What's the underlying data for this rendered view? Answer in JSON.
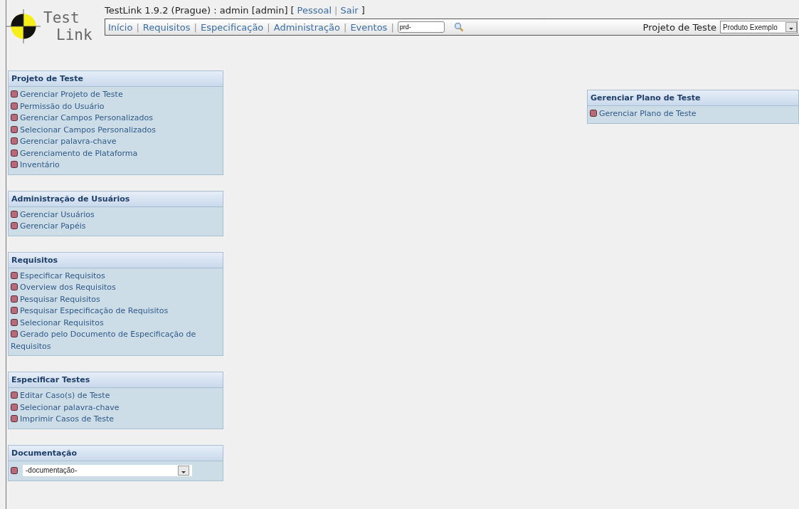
{
  "logo": {
    "top": "Test",
    "bottom": "Link"
  },
  "header": {
    "title": "TestLink 1.9.2 (Prague) : admin [admin]",
    "open": "[",
    "links": [
      "Pessoal",
      "Sair"
    ],
    "separator": "|",
    "close": "]"
  },
  "nav": {
    "items": [
      "Início",
      "Requisitos",
      "Especificação",
      "Administração",
      "Eventos"
    ],
    "separator": "|",
    "search": {
      "value": "prd-"
    }
  },
  "project": {
    "label": "Projeto de Teste",
    "value": "Produto Exemplo"
  },
  "left_panels": [
    {
      "title": "Projeto de Teste",
      "kind": "links",
      "items": [
        "Gerenciar Projeto de Teste",
        "Permissão do Usuário",
        "Gerenciar Campos Personalizados",
        "Selecionar Campos Personalizados",
        "Gerenciar palavra-chave",
        "Gerenciamento de Plataforma",
        "Inventário"
      ]
    },
    {
      "title": "Administração de Usuários",
      "kind": "links",
      "items": [
        "Gerenciar Usuários",
        "Gerenciar Papéis"
      ]
    },
    {
      "title": "Requisitos",
      "kind": "links",
      "items": [
        "Especificar Requisitos",
        "Overview dos Requisitos",
        "Pesquisar Requisitos",
        "Pesquisar Especificação de Requisitos",
        "Selecionar Requisitos",
        "Gerado pelo Documento de Especificação de Requisitos"
      ]
    },
    {
      "title": "Especificar Testes",
      "kind": "links",
      "items": [
        "Editar Caso(s) de Teste",
        "Selecionar palavra-chave",
        "Imprimir Casos de Teste"
      ]
    },
    {
      "title": "Documentação",
      "kind": "select",
      "value": "-documentação-"
    }
  ],
  "right_panels": [
    {
      "title": "Gerenciar Plano de Teste",
      "kind": "links",
      "items": [
        "Gerenciar Plano de Teste"
      ]
    }
  ]
}
